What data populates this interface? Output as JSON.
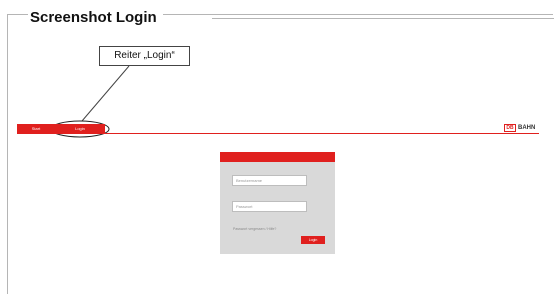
{
  "document": {
    "section_title": "Screenshot Login"
  },
  "callout": {
    "label": "Reiter „Login“"
  },
  "nav": {
    "tabs": [
      {
        "label": "Start"
      },
      {
        "label": "Login"
      }
    ],
    "accent_color": "#e0201e"
  },
  "brand": {
    "logo_text": "DB",
    "name": "BAHN"
  },
  "login_form": {
    "username_placeholder": "Benutzername",
    "password_placeholder": "Passwort",
    "forgot_link": "Passwort vergessen / Hilfe?",
    "submit_label": "Login"
  }
}
